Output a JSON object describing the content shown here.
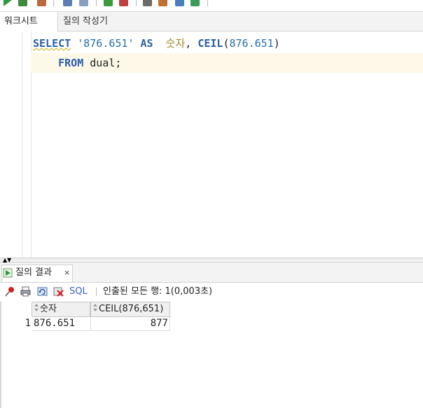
{
  "toolbar": {
    "icons": [
      "run-statement-icon",
      "run-script-icon",
      "db-icon",
      "commit-icon",
      "rollback-icon",
      "explain-icon",
      "autotrace-icon",
      "clear-icon",
      "sql-tuning-icon",
      "format-icon",
      "history-icon",
      "find-icon"
    ]
  },
  "tabs": {
    "worksheet": "워크시트",
    "query_builder": "질의 작성기"
  },
  "editor": {
    "line1": {
      "kw_select": "SELECT",
      "str": "'876.651'",
      "kw_as": "AS",
      "alias": "숫자",
      "comma": ",",
      "fn": "CEIL",
      "open": "(",
      "num": "876.651",
      "close": ")"
    },
    "line2": {
      "kw_from": "FROM",
      "rest": "dual;"
    }
  },
  "results": {
    "tab_label": "질의 결과",
    "tab_close": "×",
    "sql_link": "SQL",
    "status": "인출된 모든 행: 1(0,003초)",
    "columns": [
      "숫자",
      "CEIL(876,651)"
    ],
    "rows": [
      {
        "num": "1",
        "values": [
          "876.651",
          "877"
        ]
      }
    ]
  },
  "colors": {
    "keyword": "#2a5ea8",
    "alias": "#a08a2a",
    "current_line": "#fdf8e8",
    "link": "#3b63c4"
  }
}
